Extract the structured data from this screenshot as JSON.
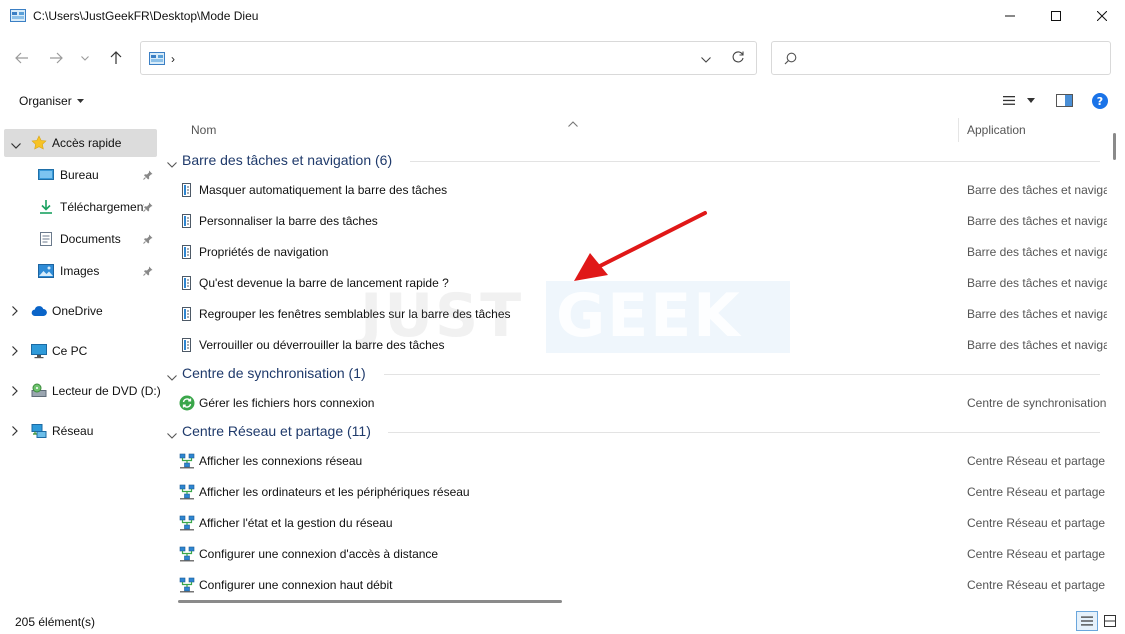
{
  "window": {
    "title": "C:\\Users\\JustGeekFR\\Desktop\\Mode Dieu"
  },
  "address": {
    "chevron": "›"
  },
  "search": {
    "placeholder": ""
  },
  "commandbar": {
    "organiser_label": "Organiser"
  },
  "sidebar": {
    "items": [
      {
        "label": "Accès rapide",
        "icon": "star-icon",
        "active": true
      },
      {
        "label": "Bureau",
        "icon": "desktop-icon",
        "pinned": true
      },
      {
        "label": "Téléchargements",
        "icon": "download-icon",
        "pinned": true
      },
      {
        "label": "Documents",
        "icon": "documents-icon",
        "pinned": true
      },
      {
        "label": "Images",
        "icon": "images-icon",
        "pinned": true
      },
      {
        "label": "OneDrive",
        "icon": "cloud-icon"
      },
      {
        "label": "Ce PC",
        "icon": "computer-icon"
      },
      {
        "label": "Lecteur de DVD (D:)",
        "icon": "dvd-icon"
      },
      {
        "label": "Réseau",
        "icon": "network-icon"
      }
    ]
  },
  "columns": {
    "name": "Nom",
    "application": "Application"
  },
  "groups": [
    {
      "label": "Barre des tâches et navigation (6)",
      "items": [
        {
          "name": "Masquer automatiquement la barre des tâches",
          "app": "Barre des tâches et navigat"
        },
        {
          "name": "Personnaliser la barre des tâches",
          "app": "Barre des tâches et navigat"
        },
        {
          "name": "Propriétés de navigation",
          "app": "Barre des tâches et navigat"
        },
        {
          "name": "Qu'est devenue la barre de lancement rapide ?",
          "app": "Barre des tâches et navigat"
        },
        {
          "name": "Regrouper les fenêtres semblables sur la barre des tâches",
          "app": "Barre des tâches et navigat"
        },
        {
          "name": "Verrouiller ou déverrouiller la barre des tâches",
          "app": "Barre des tâches et navigat"
        }
      ]
    },
    {
      "label": "Centre de synchronisation (1)",
      "items": [
        {
          "name": "Gérer les fichiers hors connexion",
          "app": "Centre de synchronisation"
        }
      ]
    },
    {
      "label": "Centre Réseau et partage (11)",
      "items": [
        {
          "name": "Afficher les connexions réseau",
          "app": "Centre Réseau et partage"
        },
        {
          "name": "Afficher les ordinateurs et les périphériques réseau",
          "app": "Centre Réseau et partage"
        },
        {
          "name": "Afficher l'état et la gestion du réseau",
          "app": "Centre Réseau et partage"
        },
        {
          "name": "Configurer une connexion d'accès à distance",
          "app": "Centre Réseau et partage"
        },
        {
          "name": "Configurer une connexion haut débit",
          "app": "Centre Réseau et partage"
        }
      ]
    }
  ],
  "status": {
    "count": "205 élément(s)"
  },
  "watermark": {
    "part1": "JUST",
    "part2": "GEEK"
  },
  "colors": {
    "accent": "#0078d4",
    "group_header": "#1f3a6b",
    "annotation_arrow": "#e01818"
  }
}
